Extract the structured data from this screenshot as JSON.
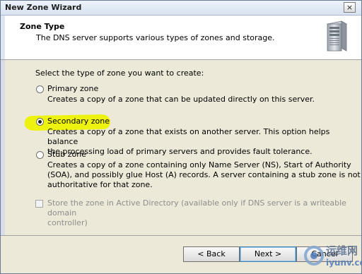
{
  "window": {
    "title": "New Zone Wizard",
    "close_glyph": "×"
  },
  "header": {
    "title": "Zone Type",
    "subtitle": "The DNS server supports various types of zones and storage.",
    "icon": "server-tower-icon"
  },
  "body": {
    "prompt": "Select the type of zone you want to create:",
    "options": [
      {
        "label": "Primary zone",
        "selected": false,
        "description": [
          "Creates a copy of a zone that can be updated directly on this server."
        ]
      },
      {
        "label": "Secondary zone",
        "selected": true,
        "highlighted": true,
        "description": [
          "Creates a copy of a zone that exists on another server. This option helps balance",
          "the processing load of primary servers and provides fault tolerance."
        ]
      },
      {
        "label": "Stub zone",
        "selected": false,
        "description": [
          "Creates a copy of a zone containing only Name Server (NS), Start of Authority",
          "(SOA), and possibly glue Host (A) records. A server containing a stub zone is not",
          "authoritative for that zone."
        ]
      }
    ],
    "ad_checkbox": {
      "checked": false,
      "enabled": false,
      "label": [
        "Store the zone in Active Directory (available only if DNS server is a writeable domain",
        "controller)"
      ]
    }
  },
  "footer": {
    "back_label": "< Back",
    "next_label": "Next >",
    "cancel_label": "Cancel"
  },
  "watermark": {
    "text_cn": "运维网",
    "text_domain": "iyunv.com"
  },
  "colors": {
    "highlight": "#eef20f",
    "disabled_text": "#8d8d8d",
    "dialog_bg": "#ece9d8"
  }
}
